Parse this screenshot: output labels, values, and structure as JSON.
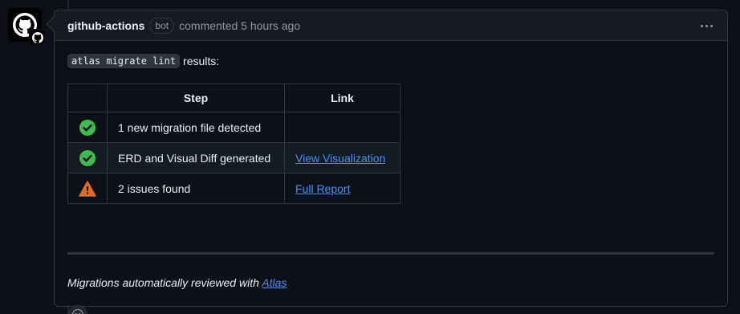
{
  "comment": {
    "author": "github-actions",
    "badge": "bot",
    "meta": "commented 5 hours ago"
  },
  "body": {
    "command": "atlas migrate lint",
    "command_suffix": "results:",
    "table": {
      "headers": [
        "",
        "Step",
        "Link"
      ],
      "rows": [
        {
          "status_icon": "check-circle-icon",
          "status_color": "#3fb950",
          "step": "1 new migration file detected",
          "link": ""
        },
        {
          "status_icon": "check-circle-icon",
          "status_color": "#3fb950",
          "step": "ERD and Visual Diff generated",
          "link": "View Visualization"
        },
        {
          "status_icon": "warning-icon",
          "status_color": "#db6d28",
          "step": "2 issues found",
          "link": "Full Report"
        }
      ]
    },
    "footer_prefix": "Migrations automatically reviewed with ",
    "footer_link": "Atlas"
  },
  "colors": {
    "background": "#0d1117",
    "header": "#161b22",
    "border": "#30363d",
    "link": "#4493f8",
    "success": "#3fb950",
    "warning": "#db6d28"
  }
}
